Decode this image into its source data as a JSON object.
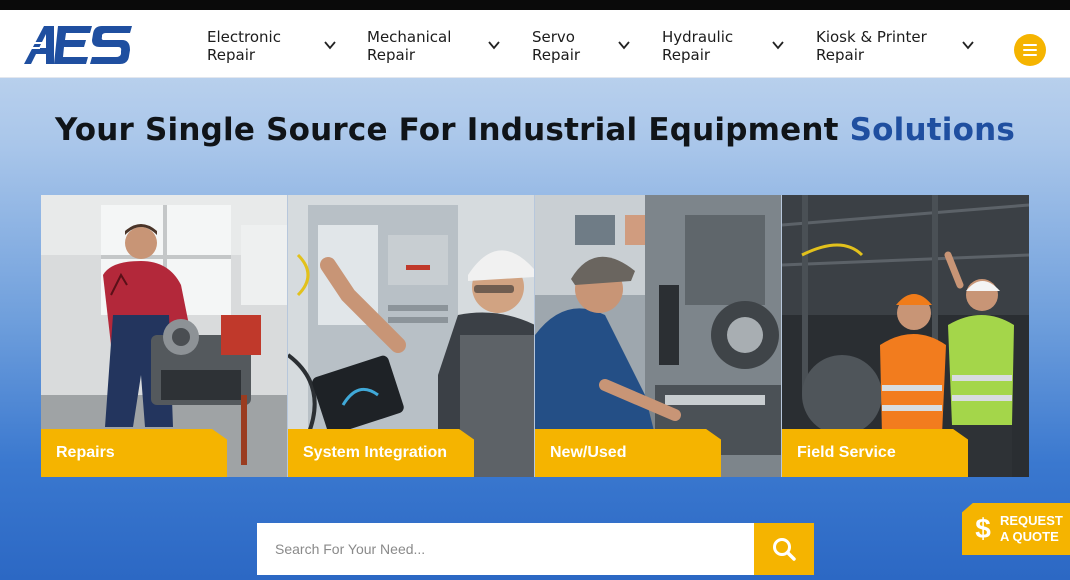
{
  "brand": {
    "logo_text": "AES",
    "accent": "#1f4fa0",
    "highlight": "#f5b400"
  },
  "nav": {
    "items": [
      {
        "label": "Electronic\nRepair"
      },
      {
        "label": "Mechanical\nRepair"
      },
      {
        "label": "Servo\nRepair"
      },
      {
        "label": "Hydraulic\nRepair"
      },
      {
        "label": "Kiosk & Printer\nRepair"
      }
    ],
    "menu_icon": "hamburger-icon"
  },
  "hero": {
    "headline_main": "Your Single Source For Industrial Equipment ",
    "headline_accent": "Solutions"
  },
  "tiles": [
    {
      "label": "Repairs"
    },
    {
      "label": "System Integration"
    },
    {
      "label": "New/Used"
    },
    {
      "label": "Field Service"
    }
  ],
  "search": {
    "placeholder": "Search For Your Need...",
    "value": "",
    "icon": "search-icon"
  },
  "quote": {
    "symbol": "$",
    "label": "REQUEST\nA QUOTE"
  }
}
